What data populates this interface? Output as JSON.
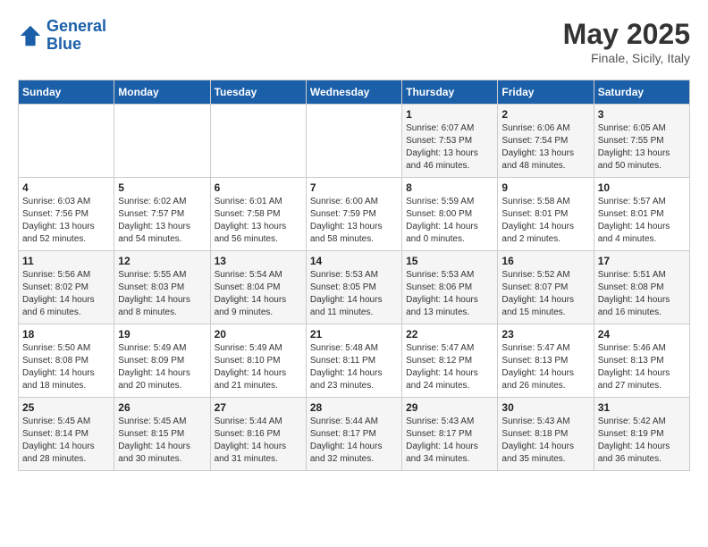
{
  "header": {
    "logo_line1": "General",
    "logo_line2": "Blue",
    "month": "May 2025",
    "location": "Finale, Sicily, Italy"
  },
  "days_of_week": [
    "Sunday",
    "Monday",
    "Tuesday",
    "Wednesday",
    "Thursday",
    "Friday",
    "Saturday"
  ],
  "weeks": [
    [
      {
        "day": "",
        "info": ""
      },
      {
        "day": "",
        "info": ""
      },
      {
        "day": "",
        "info": ""
      },
      {
        "day": "",
        "info": ""
      },
      {
        "day": "1",
        "info": "Sunrise: 6:07 AM\nSunset: 7:53 PM\nDaylight: 13 hours\nand 46 minutes."
      },
      {
        "day": "2",
        "info": "Sunrise: 6:06 AM\nSunset: 7:54 PM\nDaylight: 13 hours\nand 48 minutes."
      },
      {
        "day": "3",
        "info": "Sunrise: 6:05 AM\nSunset: 7:55 PM\nDaylight: 13 hours\nand 50 minutes."
      }
    ],
    [
      {
        "day": "4",
        "info": "Sunrise: 6:03 AM\nSunset: 7:56 PM\nDaylight: 13 hours\nand 52 minutes."
      },
      {
        "day": "5",
        "info": "Sunrise: 6:02 AM\nSunset: 7:57 PM\nDaylight: 13 hours\nand 54 minutes."
      },
      {
        "day": "6",
        "info": "Sunrise: 6:01 AM\nSunset: 7:58 PM\nDaylight: 13 hours\nand 56 minutes."
      },
      {
        "day": "7",
        "info": "Sunrise: 6:00 AM\nSunset: 7:59 PM\nDaylight: 13 hours\nand 58 minutes."
      },
      {
        "day": "8",
        "info": "Sunrise: 5:59 AM\nSunset: 8:00 PM\nDaylight: 14 hours\nand 0 minutes."
      },
      {
        "day": "9",
        "info": "Sunrise: 5:58 AM\nSunset: 8:01 PM\nDaylight: 14 hours\nand 2 minutes."
      },
      {
        "day": "10",
        "info": "Sunrise: 5:57 AM\nSunset: 8:01 PM\nDaylight: 14 hours\nand 4 minutes."
      }
    ],
    [
      {
        "day": "11",
        "info": "Sunrise: 5:56 AM\nSunset: 8:02 PM\nDaylight: 14 hours\nand 6 minutes."
      },
      {
        "day": "12",
        "info": "Sunrise: 5:55 AM\nSunset: 8:03 PM\nDaylight: 14 hours\nand 8 minutes."
      },
      {
        "day": "13",
        "info": "Sunrise: 5:54 AM\nSunset: 8:04 PM\nDaylight: 14 hours\nand 9 minutes."
      },
      {
        "day": "14",
        "info": "Sunrise: 5:53 AM\nSunset: 8:05 PM\nDaylight: 14 hours\nand 11 minutes."
      },
      {
        "day": "15",
        "info": "Sunrise: 5:53 AM\nSunset: 8:06 PM\nDaylight: 14 hours\nand 13 minutes."
      },
      {
        "day": "16",
        "info": "Sunrise: 5:52 AM\nSunset: 8:07 PM\nDaylight: 14 hours\nand 15 minutes."
      },
      {
        "day": "17",
        "info": "Sunrise: 5:51 AM\nSunset: 8:08 PM\nDaylight: 14 hours\nand 16 minutes."
      }
    ],
    [
      {
        "day": "18",
        "info": "Sunrise: 5:50 AM\nSunset: 8:08 PM\nDaylight: 14 hours\nand 18 minutes."
      },
      {
        "day": "19",
        "info": "Sunrise: 5:49 AM\nSunset: 8:09 PM\nDaylight: 14 hours\nand 20 minutes."
      },
      {
        "day": "20",
        "info": "Sunrise: 5:49 AM\nSunset: 8:10 PM\nDaylight: 14 hours\nand 21 minutes."
      },
      {
        "day": "21",
        "info": "Sunrise: 5:48 AM\nSunset: 8:11 PM\nDaylight: 14 hours\nand 23 minutes."
      },
      {
        "day": "22",
        "info": "Sunrise: 5:47 AM\nSunset: 8:12 PM\nDaylight: 14 hours\nand 24 minutes."
      },
      {
        "day": "23",
        "info": "Sunrise: 5:47 AM\nSunset: 8:13 PM\nDaylight: 14 hours\nand 26 minutes."
      },
      {
        "day": "24",
        "info": "Sunrise: 5:46 AM\nSunset: 8:13 PM\nDaylight: 14 hours\nand 27 minutes."
      }
    ],
    [
      {
        "day": "25",
        "info": "Sunrise: 5:45 AM\nSunset: 8:14 PM\nDaylight: 14 hours\nand 28 minutes."
      },
      {
        "day": "26",
        "info": "Sunrise: 5:45 AM\nSunset: 8:15 PM\nDaylight: 14 hours\nand 30 minutes."
      },
      {
        "day": "27",
        "info": "Sunrise: 5:44 AM\nSunset: 8:16 PM\nDaylight: 14 hours\nand 31 minutes."
      },
      {
        "day": "28",
        "info": "Sunrise: 5:44 AM\nSunset: 8:17 PM\nDaylight: 14 hours\nand 32 minutes."
      },
      {
        "day": "29",
        "info": "Sunrise: 5:43 AM\nSunset: 8:17 PM\nDaylight: 14 hours\nand 34 minutes."
      },
      {
        "day": "30",
        "info": "Sunrise: 5:43 AM\nSunset: 8:18 PM\nDaylight: 14 hours\nand 35 minutes."
      },
      {
        "day": "31",
        "info": "Sunrise: 5:42 AM\nSunset: 8:19 PM\nDaylight: 14 hours\nand 36 minutes."
      }
    ]
  ]
}
